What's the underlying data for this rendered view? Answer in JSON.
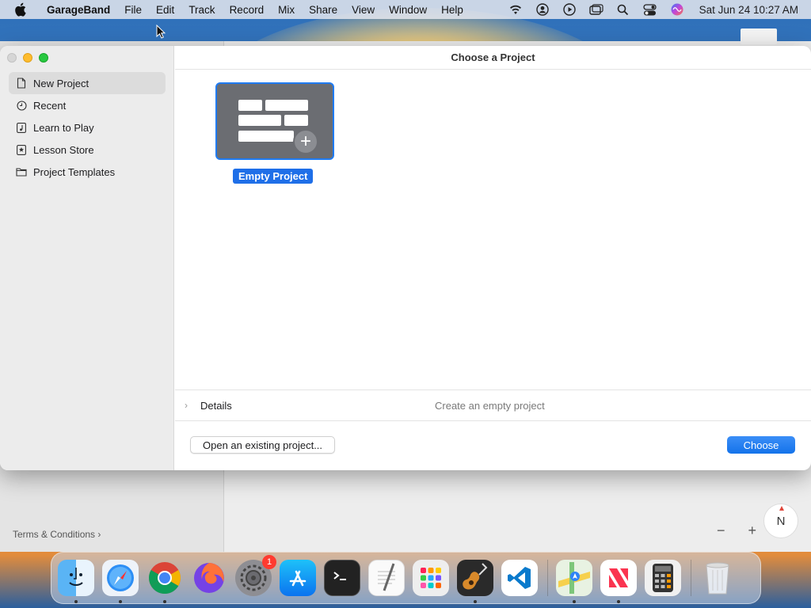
{
  "menubar": {
    "app_name": "GarageBand",
    "items": [
      "File",
      "Edit",
      "Track",
      "Record",
      "Mix",
      "Share",
      "View",
      "Window",
      "Help"
    ],
    "clock": "Sat Jun 24  10:27 AM"
  },
  "dialog": {
    "title": "Choose a Project",
    "sidebar": {
      "items": [
        {
          "label": "New Project",
          "icon": "document-icon",
          "selected": true
        },
        {
          "label": "Recent",
          "icon": "clock-icon",
          "selected": false
        },
        {
          "label": "Learn to Play",
          "icon": "music-note-icon",
          "selected": false
        },
        {
          "label": "Lesson Store",
          "icon": "star-icon",
          "selected": false
        },
        {
          "label": "Project Templates",
          "icon": "folder-icon",
          "selected": false
        }
      ]
    },
    "project_tile": {
      "label": "Empty Project"
    },
    "details": {
      "label": "Details",
      "description": "Create an empty project"
    },
    "buttons": {
      "open_existing": "Open an existing project...",
      "choose": "Choose"
    }
  },
  "background": {
    "terms_label": "Terms & Conditions",
    "compass_label": "N",
    "zoom_out": "−",
    "zoom_in": "+"
  },
  "dock": {
    "apps": [
      "Finder",
      "Safari",
      "Chrome",
      "Firefox",
      "System Settings",
      "App Store",
      "Terminal",
      "TextEdit",
      "Launchpad",
      "GarageBand",
      "VS Code",
      "Maps",
      "News",
      "Calculator",
      "Trash"
    ],
    "settings_badge": "1"
  },
  "colors": {
    "accent": "#1f6fe8",
    "selected_row": "#dcdcdc"
  }
}
